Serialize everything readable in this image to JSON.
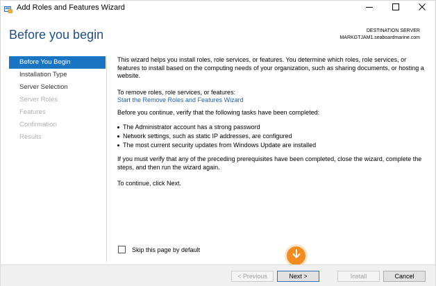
{
  "window": {
    "title": "Add Roles and Features Wizard",
    "icons": {
      "app": "server-manager-icon",
      "minimize": "minimize-icon",
      "maximize": "maximize-icon",
      "close": "close-icon"
    }
  },
  "header": {
    "page_title": "Before you begin",
    "destination_label": "DESTINATION SERVER",
    "destination_server": "MARKGTJAM1.seaboardmarine.com"
  },
  "sidebar": {
    "items": [
      {
        "label": "Before You Begin",
        "state": "active"
      },
      {
        "label": "Installation Type",
        "state": "enabled"
      },
      {
        "label": "Server Selection",
        "state": "enabled"
      },
      {
        "label": "Server Roles",
        "state": "disabled"
      },
      {
        "label": "Features",
        "state": "disabled"
      },
      {
        "label": "Confirmation",
        "state": "disabled"
      },
      {
        "label": "Results",
        "state": "disabled"
      }
    ]
  },
  "content": {
    "intro": "This wizard helps you install roles, role services, or features. You determine which roles, role services, or features to install based on the computing needs of your organization, such as sharing documents, or hosting a website.",
    "remove_label": "To remove roles, role services, or features:",
    "remove_link": "Start the Remove Roles and Features Wizard",
    "verify_text": "Before you continue, verify that the following tasks have been completed:",
    "bullets": [
      "The Administrator account has a strong password",
      "Network settings, such as static IP addresses, are configured",
      "The most current security updates from Windows Update are installed"
    ],
    "prereq_text": "If you must verify that any of the preceding prerequisites have been completed, close the wizard, complete the steps, and then run the wizard again.",
    "continue_text": "To continue, click Next."
  },
  "skip": {
    "label": "Skip this page by default",
    "checked": false
  },
  "marker": {
    "icon": "arrow-down-icon",
    "color": "#f28c1e"
  },
  "footer": {
    "previous_label": "< Previous",
    "next_label": "Next >",
    "install_label": "Install",
    "cancel_label": "Cancel"
  },
  "colors": {
    "accent": "#1a74c4",
    "title": "#1e4f89",
    "link": "#1f5fa8"
  }
}
